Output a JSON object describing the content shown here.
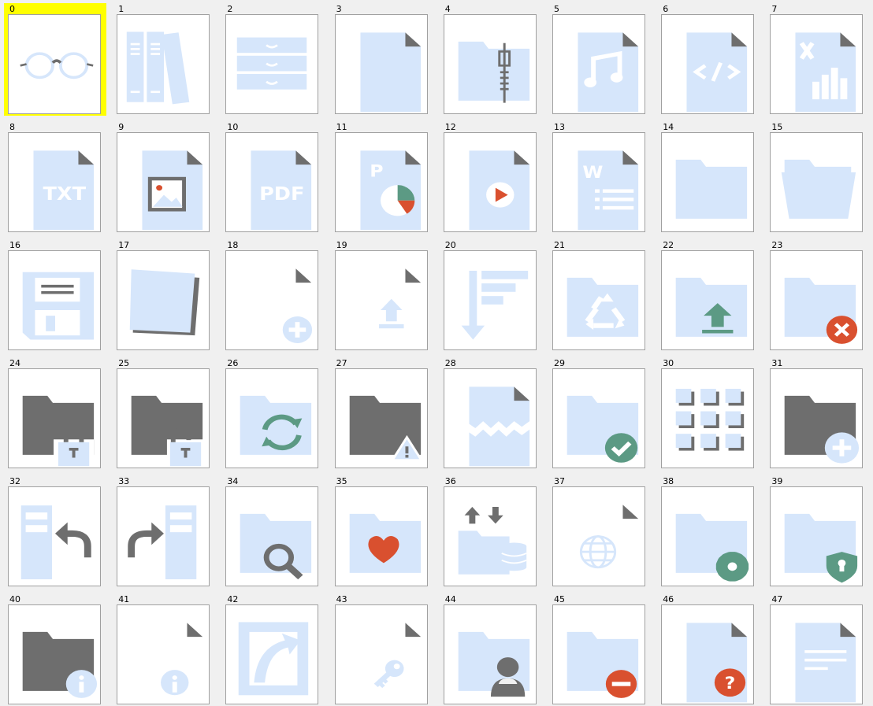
{
  "grid": {
    "columns": 8,
    "rows": 7,
    "selected_index": 0,
    "selection_color": "#ffff00",
    "colors": {
      "light_blue": "#d6e6fb",
      "gray": "#6e6e6e",
      "green": "#5c9a84",
      "red": "#d9502f",
      "white": "#ffffff"
    },
    "items": [
      {
        "number": "0",
        "icon": "glasses-icon"
      },
      {
        "number": "1",
        "icon": "binders-icon"
      },
      {
        "number": "2",
        "icon": "drawers-cabinet-icon"
      },
      {
        "number": "3",
        "icon": "blank-file-icon"
      },
      {
        "number": "4",
        "icon": "zip-folder-icon"
      },
      {
        "number": "5",
        "icon": "audio-file-icon"
      },
      {
        "number": "6",
        "icon": "code-file-icon"
      },
      {
        "number": "7",
        "icon": "excel-file-icon"
      },
      {
        "number": "8",
        "icon": "txt-file-icon",
        "text": "TXT"
      },
      {
        "number": "9",
        "icon": "image-file-icon"
      },
      {
        "number": "10",
        "icon": "pdf-file-icon",
        "text": "PDF"
      },
      {
        "number": "11",
        "icon": "powerpoint-file-icon",
        "text": "P"
      },
      {
        "number": "12",
        "icon": "video-file-icon"
      },
      {
        "number": "13",
        "icon": "word-file-icon",
        "text": "W"
      },
      {
        "number": "14",
        "icon": "folder-closed-icon"
      },
      {
        "number": "15",
        "icon": "folder-open-icon"
      },
      {
        "number": "16",
        "icon": "floppy-disk-icon"
      },
      {
        "number": "17",
        "icon": "sticky-notes-icon"
      },
      {
        "number": "18",
        "icon": "new-file-icon"
      },
      {
        "number": "19",
        "icon": "upload-file-icon"
      },
      {
        "number": "20",
        "icon": "sort-descending-icon"
      },
      {
        "number": "21",
        "icon": "recycle-folder-icon"
      },
      {
        "number": "22",
        "icon": "upload-folder-icon"
      },
      {
        "number": "23",
        "icon": "folder-error-icon"
      },
      {
        "number": "24",
        "icon": "folder-locked-icon"
      },
      {
        "number": "25",
        "icon": "folder-unlocked-icon"
      },
      {
        "number": "26",
        "icon": "folder-sync-icon"
      },
      {
        "number": "27",
        "icon": "folder-warning-icon"
      },
      {
        "number": "28",
        "icon": "broken-file-icon"
      },
      {
        "number": "29",
        "icon": "folder-check-icon"
      },
      {
        "number": "30",
        "icon": "grid-view-icon"
      },
      {
        "number": "31",
        "icon": "folder-add-icon"
      },
      {
        "number": "32",
        "icon": "panel-redo-icon"
      },
      {
        "number": "33",
        "icon": "panel-undo-icon"
      },
      {
        "number": "34",
        "icon": "folder-search-icon"
      },
      {
        "number": "35",
        "icon": "folder-favorite-icon"
      },
      {
        "number": "36",
        "icon": "folder-database-transfer-icon"
      },
      {
        "number": "37",
        "icon": "network-file-icon"
      },
      {
        "number": "38",
        "icon": "folder-settings-icon"
      },
      {
        "number": "39",
        "icon": "folder-protected-icon"
      },
      {
        "number": "40",
        "icon": "folder-info-icon"
      },
      {
        "number": "41",
        "icon": "file-info-icon"
      },
      {
        "number": "42",
        "icon": "shortcut-icon"
      },
      {
        "number": "43",
        "icon": "file-key-icon"
      },
      {
        "number": "44",
        "icon": "user-folder-icon"
      },
      {
        "number": "45",
        "icon": "folder-remove-icon"
      },
      {
        "number": "46",
        "icon": "file-help-icon",
        "text": "?"
      },
      {
        "number": "47",
        "icon": "text-document-icon"
      }
    ]
  }
}
